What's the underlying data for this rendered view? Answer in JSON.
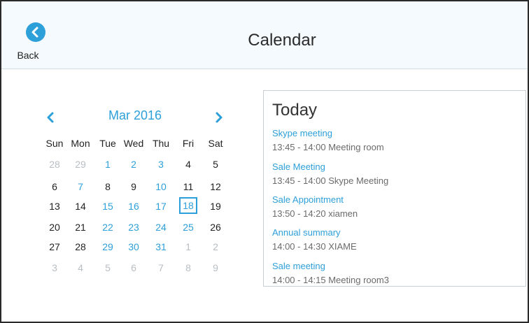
{
  "header": {
    "title": "Calendar",
    "back_label": "Back",
    "accent": "#2d9fd9"
  },
  "calendar": {
    "month_label": "Mar 2016",
    "days_of_week": [
      "Sun",
      "Mon",
      "Tue",
      "Wed",
      "Thu",
      "Fri",
      "Sat"
    ],
    "selected_day": "18",
    "weeks": [
      [
        {
          "d": "28",
          "s": "muted"
        },
        {
          "d": "29",
          "s": "muted"
        },
        {
          "d": "1",
          "s": "highlight"
        },
        {
          "d": "2",
          "s": "highlight"
        },
        {
          "d": "3",
          "s": "highlight"
        },
        {
          "d": "4",
          "s": "normal"
        },
        {
          "d": "5",
          "s": "normal"
        }
      ],
      [
        {
          "d": "6",
          "s": "normal"
        },
        {
          "d": "7",
          "s": "highlight"
        },
        {
          "d": "8",
          "s": "normal"
        },
        {
          "d": "9",
          "s": "normal"
        },
        {
          "d": "10",
          "s": "highlight"
        },
        {
          "d": "11",
          "s": "normal"
        },
        {
          "d": "12",
          "s": "normal"
        }
      ],
      [
        {
          "d": "13",
          "s": "normal"
        },
        {
          "d": "14",
          "s": "normal"
        },
        {
          "d": "15",
          "s": "highlight"
        },
        {
          "d": "16",
          "s": "highlight"
        },
        {
          "d": "17",
          "s": "highlight"
        },
        {
          "d": "18",
          "s": "selected"
        },
        {
          "d": "19",
          "s": "normal"
        }
      ],
      [
        {
          "d": "20",
          "s": "normal"
        },
        {
          "d": "21",
          "s": "normal"
        },
        {
          "d": "22",
          "s": "highlight"
        },
        {
          "d": "23",
          "s": "highlight"
        },
        {
          "d": "24",
          "s": "highlight"
        },
        {
          "d": "25",
          "s": "highlight"
        },
        {
          "d": "26",
          "s": "normal"
        }
      ],
      [
        {
          "d": "27",
          "s": "normal"
        },
        {
          "d": "28",
          "s": "normal"
        },
        {
          "d": "29",
          "s": "highlight"
        },
        {
          "d": "30",
          "s": "highlight"
        },
        {
          "d": "31",
          "s": "highlight"
        },
        {
          "d": "1",
          "s": "muted"
        },
        {
          "d": "2",
          "s": "muted"
        }
      ],
      [
        {
          "d": "3",
          "s": "muted"
        },
        {
          "d": "4",
          "s": "muted"
        },
        {
          "d": "5",
          "s": "muted"
        },
        {
          "d": "6",
          "s": "muted"
        },
        {
          "d": "7",
          "s": "muted"
        },
        {
          "d": "8",
          "s": "muted"
        },
        {
          "d": "9",
          "s": "muted"
        }
      ]
    ]
  },
  "today": {
    "title": "Today",
    "events": [
      {
        "title": "Skype meeting",
        "detail": "13:45 - 14:00 Meeting room"
      },
      {
        "title": "Sale Meeting",
        "detail": "13:45 - 14:00 Skype Meeting"
      },
      {
        "title": "Sale Appointment",
        "detail": "13:50 - 14:20 xiamen"
      },
      {
        "title": "Annual summary",
        "detail": "14:00 - 14:30 XIAME"
      },
      {
        "title": "Sale meeting",
        "detail": "14:00 - 14:15 Meeting room3"
      }
    ]
  }
}
